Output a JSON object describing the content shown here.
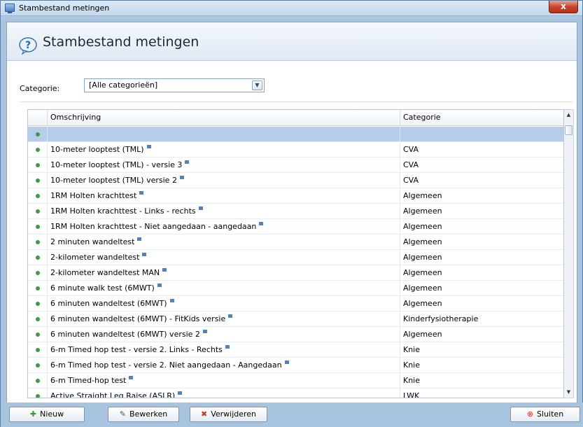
{
  "window": {
    "title": "Stambestand metingen",
    "close_label": "x"
  },
  "header": {
    "title": "Stambestand metingen"
  },
  "filter": {
    "label": "Categorie:",
    "value": "[Alle categorieën]"
  },
  "grid": {
    "columns": [
      "Omschrijving",
      "Categorie"
    ],
    "rows": [
      {
        "name": "",
        "category": "",
        "note": false,
        "selected": true
      },
      {
        "name": "10-meter looptest (TML)",
        "category": "CVA",
        "note": true
      },
      {
        "name": "10-meter looptest (TML) - versie 3",
        "category": "CVA",
        "note": true
      },
      {
        "name": "10-meter looptest (TML) versie 2",
        "category": "CVA",
        "note": true
      },
      {
        "name": "1RM Holten krachttest",
        "category": "Algemeen",
        "note": true
      },
      {
        "name": "1RM Holten krachttest - Links - rechts",
        "category": "Algemeen",
        "note": true
      },
      {
        "name": "1RM Holten krachttest - Niet aangedaan - aangedaan",
        "category": "Algemeen",
        "note": true
      },
      {
        "name": "2 minuten wandeltest",
        "category": "Algemeen",
        "note": true
      },
      {
        "name": "2-kilometer wandeltest",
        "category": "Algemeen",
        "note": true
      },
      {
        "name": "2-kilometer wandeltest MAN",
        "category": "Algemeen",
        "note": true
      },
      {
        "name": "6 minute walk test (6MWT)",
        "category": "Algemeen",
        "note": true
      },
      {
        "name": "6 minuten wandeltest (6MWT)",
        "category": "Algemeen",
        "note": true
      },
      {
        "name": "6 minuten wandeltest (6MWT) - FitKids versie",
        "category": "Kinderfysiotherapie",
        "note": true
      },
      {
        "name": "6 minuten wandeltest (6MWT) versie 2",
        "category": "Algemeen",
        "note": true
      },
      {
        "name": "6-m Timed hop test - versie 2. Links - Rechts",
        "category": "Knie",
        "note": true
      },
      {
        "name": "6-m Timed hop test - versie 2. Niet aangedaan - Aangedaan",
        "category": "Knie",
        "note": true
      },
      {
        "name": "6-m Timed-hop test",
        "category": "Knie",
        "note": true
      },
      {
        "name": "Active Straight Leg Raise (ASLR)",
        "category": "LWK",
        "note": true
      }
    ]
  },
  "buttons": {
    "new": "Nieuw",
    "edit": "Bewerken",
    "delete": "Verwijderen",
    "close": "Sluiten"
  },
  "colors": {
    "status_dot": "#3e9a44",
    "selected_row": "#b6cdea",
    "note_marker": "#4a83c8"
  }
}
